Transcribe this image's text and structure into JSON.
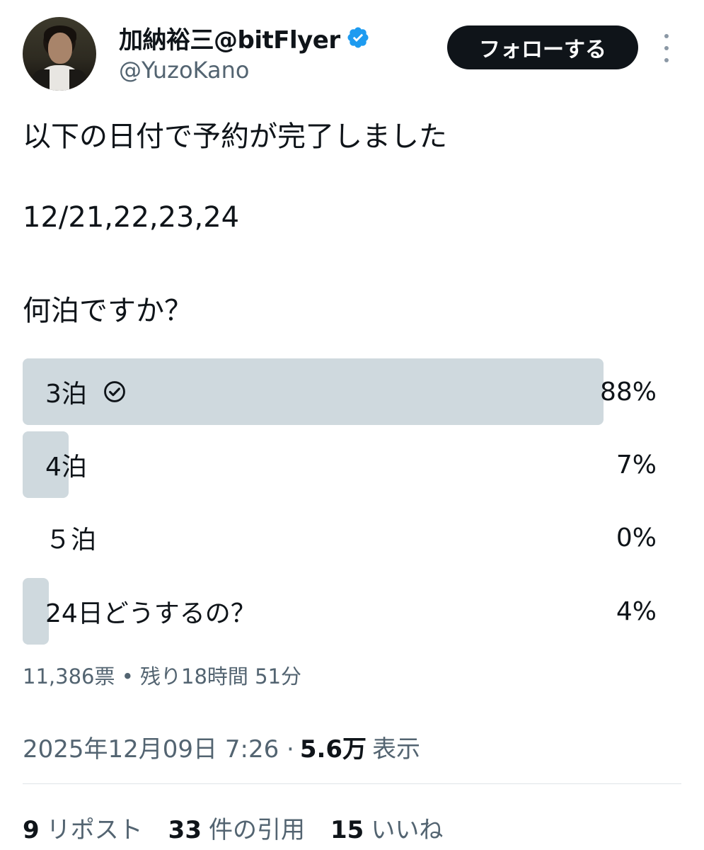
{
  "header": {
    "display_name": "加納裕三@bitFlyer",
    "handle": "@YuzoKano",
    "follow_label": "フォローする",
    "verified_color": "#1d9bf0",
    "icons": [
      "verified-badge-icon",
      "more-options-icon"
    ]
  },
  "tweet": {
    "line1": "以下の日付で予約が完了しました",
    "line2": "12/21,22,23,24",
    "line3": "何泊ですか？"
  },
  "poll": {
    "options": [
      {
        "label": "3泊",
        "percent_label": "88%",
        "share": 0.88,
        "selected": true
      },
      {
        "label": "4泊",
        "percent_label": "7%",
        "share": 0.07,
        "selected": false
      },
      {
        "label": "５泊",
        "percent_label": "0%",
        "share": 0.0,
        "selected": false
      },
      {
        "label": "24日どうするの？",
        "percent_label": "4%",
        "share": 0.04,
        "selected": false
      }
    ],
    "meta": "11,386票 • 残り18時間 51分",
    "bar_color": "#cfd9de"
  },
  "footer": {
    "timestamp": "2025年12月09日 7:26 ·",
    "views_count": "5.6万",
    "views_label": "表示",
    "reposts_count": "9",
    "reposts_label": "リポスト",
    "quotes_count": "33",
    "quotes_label": "件の引用",
    "likes_count": "15",
    "likes_label": "いいね"
  }
}
